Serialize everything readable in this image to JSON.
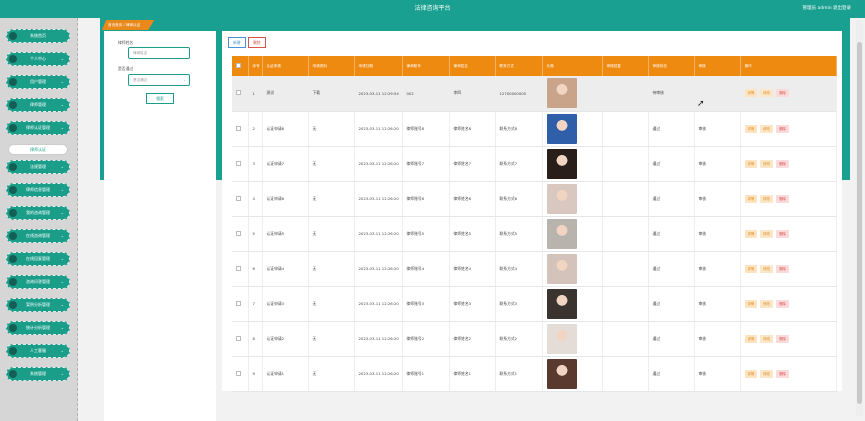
{
  "header": {
    "title": "法律咨询平台",
    "user": "管理员 admin  退出登录"
  },
  "sidebar": {
    "items": [
      {
        "label": "系统首页",
        "chevron": false
      },
      {
        "label": "个人中心",
        "chevron": true
      },
      {
        "label": "用户管理",
        "chevron": true
      },
      {
        "label": "律师管理",
        "chevron": true
      },
      {
        "label": "律师认证管理",
        "chevron": true
      },
      {
        "label": "律师认证",
        "chevron": false,
        "sub": true
      },
      {
        "label": "法规管理",
        "chevron": true
      },
      {
        "label": "律师信息管理",
        "chevron": true
      },
      {
        "label": "我的咨询管理",
        "chevron": true
      },
      {
        "label": "在线咨询管理",
        "chevron": true
      },
      {
        "label": "在线回复管理",
        "chevron": true
      },
      {
        "label": "咨询问答管理",
        "chevron": true
      },
      {
        "label": "案例分析管理",
        "chevron": true
      },
      {
        "label": "统计分析管理",
        "chevron": true
      },
      {
        "label": "人工客服",
        "chevron": true
      },
      {
        "label": "系统管理",
        "chevron": true
      }
    ]
  },
  "breadcrumb": "首页首页 / 律师认证",
  "filter": {
    "label1": "律师姓名",
    "placeholder1": "律师姓名",
    "label2": "是否通过",
    "placeholder2": "是否通过",
    "search_label": "搜索"
  },
  "toolbar": {
    "add_label": "新增",
    "delete_label": "删除"
  },
  "table": {
    "headers": [
      "",
      "序号",
      "认证申请",
      "申请资料",
      "申请日期",
      "律师账号",
      "律师姓名",
      "联系方式",
      "头像",
      "审核回复",
      "审核状态",
      "审核",
      "操作"
    ],
    "rows": [
      {
        "no": "1",
        "apply": "测试",
        "doc": "下载",
        "date": "2023-03-11 12:29:54",
        "account": "002",
        "name": "李四",
        "phone": "12700000005",
        "reply": "",
        "status": "待审核",
        "review": "",
        "hl": true,
        "photo": "#c9a38a"
      },
      {
        "no": "2",
        "apply": "认证申请8",
        "doc": "无",
        "date": "2023-03-11 12:26:20",
        "account": "律师账号8",
        "name": "律师姓名8",
        "phone": "联系方式8",
        "reply": "",
        "status": "通过",
        "review": "审核",
        "hl": false,
        "photo": "#2f5fa8"
      },
      {
        "no": "3",
        "apply": "认证申请7",
        "doc": "无",
        "date": "2023-03-11 12:26:20",
        "account": "律师账号7",
        "name": "律师姓名7",
        "phone": "联系方式7",
        "reply": "",
        "status": "通过",
        "review": "审核",
        "hl": false,
        "photo": "#2a1e1a"
      },
      {
        "no": "4",
        "apply": "认证申请6",
        "doc": "无",
        "date": "2023-03-11 12:26:20",
        "account": "律师账号6",
        "name": "律师姓名6",
        "phone": "联系方式6",
        "reply": "",
        "status": "通过",
        "review": "审核",
        "hl": false,
        "photo": "#d8c8c0"
      },
      {
        "no": "5",
        "apply": "认证申请5",
        "doc": "无",
        "date": "2023-03-11 12:26:20",
        "account": "律师账号5",
        "name": "律师姓名5",
        "phone": "联系方式5",
        "reply": "",
        "status": "通过",
        "review": "审核",
        "hl": false,
        "photo": "#b9b3ad"
      },
      {
        "no": "6",
        "apply": "认证申请4",
        "doc": "无",
        "date": "2023-03-11 12:26:20",
        "account": "律师账号4",
        "name": "律师姓名4",
        "phone": "联系方式4",
        "reply": "",
        "status": "通过",
        "review": "审核",
        "hl": false,
        "photo": "#d3c3bb"
      },
      {
        "no": "7",
        "apply": "认证申请3",
        "doc": "无",
        "date": "2023-03-11 12:26:20",
        "account": "律师账号3",
        "name": "律师姓名3",
        "phone": "联系方式3",
        "reply": "",
        "status": "通过",
        "review": "审核",
        "hl": false,
        "photo": "#3a3330"
      },
      {
        "no": "8",
        "apply": "认证申请2",
        "doc": "无",
        "date": "2023-03-11 12:26:20",
        "account": "律师账号2",
        "name": "律师姓名2",
        "phone": "联系方式2",
        "reply": "",
        "status": "通过",
        "review": "审核",
        "hl": false,
        "photo": "#e4dcd6"
      },
      {
        "no": "9",
        "apply": "认证申请1",
        "doc": "无",
        "date": "2023-03-11 12:26:20",
        "account": "律师账号1",
        "name": "律师姓名1",
        "phone": "联系方式1",
        "reply": "",
        "status": "通过",
        "review": "审核",
        "hl": false,
        "photo": "#5a3a2e"
      }
    ],
    "actions": {
      "detail": "详情",
      "edit": "修改",
      "delete": "删除"
    }
  },
  "colors": {
    "primary": "#1aa090",
    "accent": "#ef8a10",
    "danger": "#d9534f"
  }
}
